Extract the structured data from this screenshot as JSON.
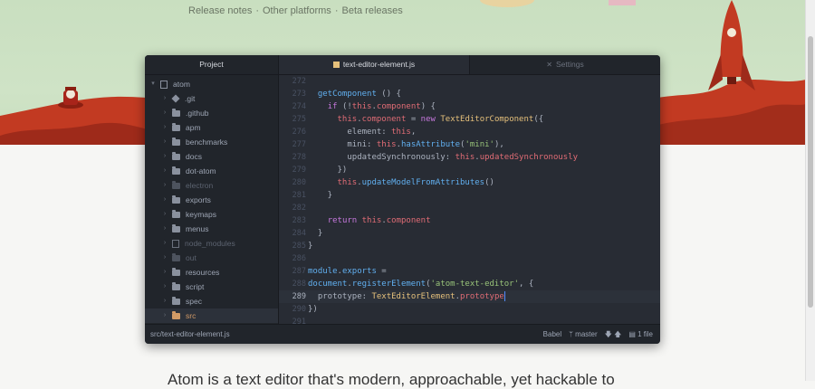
{
  "top_links": {
    "release_notes": "Release notes",
    "sep1": "·",
    "other_platforms": "Other platforms",
    "sep2": "·",
    "beta_releases": "Beta releases"
  },
  "tree": {
    "header": "Project",
    "root": "atom",
    "items": [
      {
        "label": ".git",
        "icon": "git-icon"
      },
      {
        "label": ".github",
        "icon": "folder-icon"
      },
      {
        "label": "apm",
        "icon": "folder-icon"
      },
      {
        "label": "benchmarks",
        "icon": "folder-icon"
      },
      {
        "label": "docs",
        "icon": "folder-icon"
      },
      {
        "label": "dot-atom",
        "icon": "folder-icon"
      },
      {
        "label": "electron",
        "icon": "folder-icon"
      },
      {
        "label": "exports",
        "icon": "folder-icon"
      },
      {
        "label": "keymaps",
        "icon": "folder-icon"
      },
      {
        "label": "menus",
        "icon": "folder-icon"
      },
      {
        "label": "node_modules",
        "icon": "submodule-icon"
      },
      {
        "label": "out",
        "icon": "folder-icon"
      },
      {
        "label": "resources",
        "icon": "folder-icon"
      },
      {
        "label": "script",
        "icon": "folder-icon"
      },
      {
        "label": "spec",
        "icon": "folder-icon"
      },
      {
        "label": "src",
        "icon": "folder-icon"
      }
    ]
  },
  "tabs": {
    "active": "text-editor-element.js",
    "settings": "Settings"
  },
  "editor": {
    "cursor_line": 289,
    "line_numbers": [
      "272",
      "273",
      "274",
      "275",
      "276",
      "277",
      "278",
      "279",
      "280",
      "281",
      "282",
      "283",
      "284",
      "285",
      "286",
      "287",
      "288",
      "289",
      "290",
      "291"
    ]
  },
  "status": {
    "path": "src/text-editor-element.js",
    "grammar": "Babel",
    "branch": "master",
    "files": "1 file"
  },
  "colors": {
    "editor_bg": "#282c34",
    "panel_bg": "#21252b",
    "keyword": "#c678dd",
    "function": "#61afef",
    "this": "#e06c75",
    "string": "#98c379",
    "class": "#e5c07b",
    "selected_folder": "#d19a66"
  },
  "bottom_text": "Atom is a text editor that's modern, approachable, yet hackable to"
}
